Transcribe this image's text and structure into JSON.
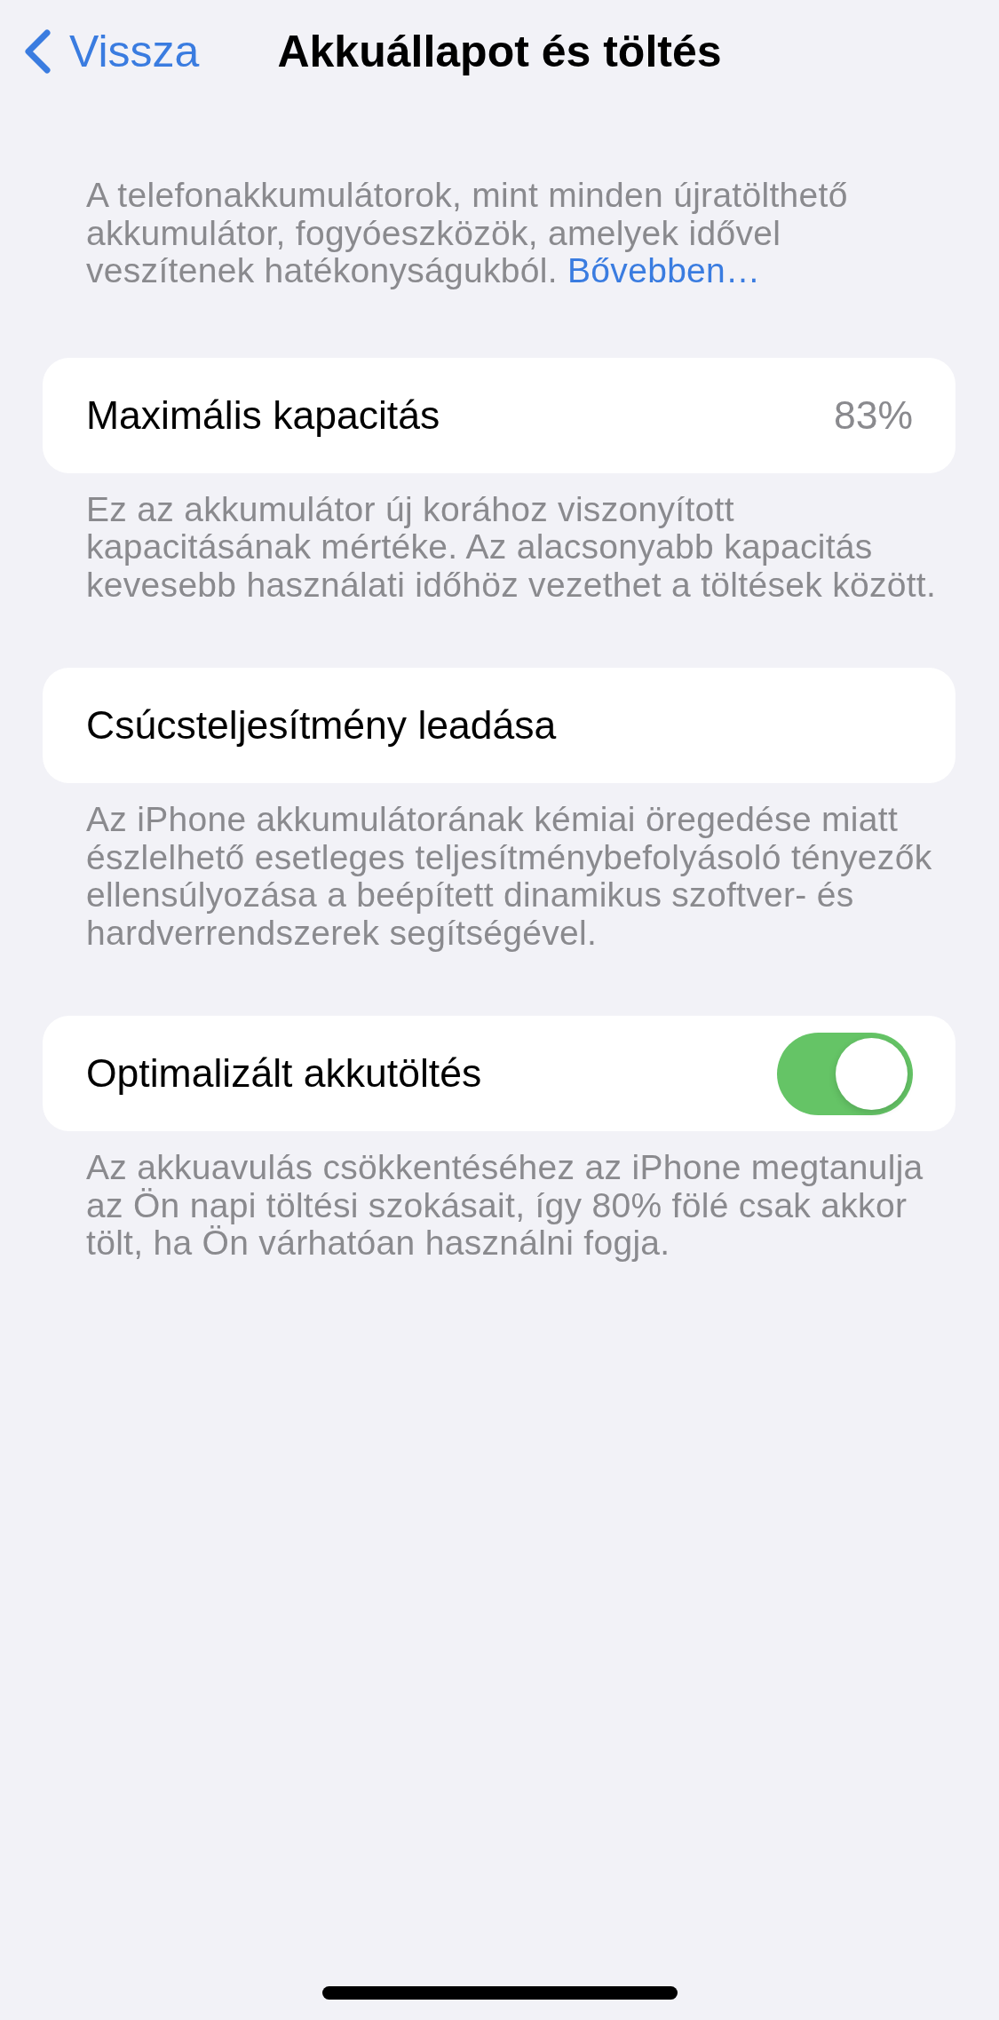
{
  "nav_bar": {
    "back_label": "Vissza",
    "title": "Akkuállapot és töltés"
  },
  "intro": {
    "text": "A telefonakkumulátorok, mint minden újratölthető akkumulátor, fogyóeszközök, amelyek idővel veszítenek hatékonyságukból.",
    "link": "Bővebben…"
  },
  "sections": [
    {
      "kind": "value",
      "label": "Maximális kapacitás",
      "value": "83%",
      "footer": "Ez az akkumulátor új korához viszonyított kapacitásának mértéke. Az alacsonyabb kapacitás kevesebb használati időhöz vezethet a töltések között."
    },
    {
      "kind": "plain",
      "label": "Csúcsteljesítmény leadása",
      "footer": "Az iPhone akkumulátorának kémiai öregedése miatt észlelhető esetleges teljesítménybefolyásoló tényezők ellensúlyozása a beépített dinamikus szoftver- és hardverrendszerek segítségével."
    },
    {
      "kind": "toggle",
      "label": "Optimalizált akkutöltés",
      "on": true,
      "footer": "Az akkuavulás csökkentéséhez az iPhone megtanulja az Ön napi töltési szokásait, így 80% fölé csak akkor tölt, ha Ön várhatóan használni fogja."
    }
  ]
}
